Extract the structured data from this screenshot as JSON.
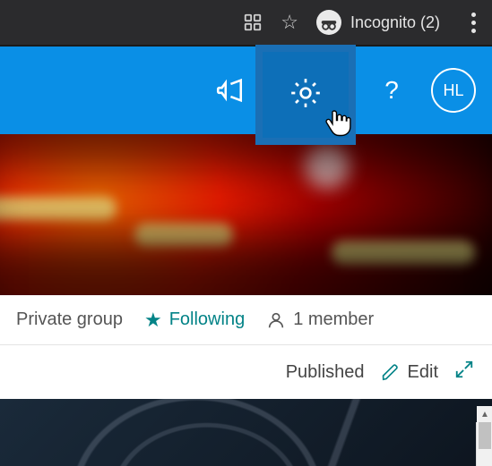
{
  "browser": {
    "incognito_label": "Incognito (2)"
  },
  "header": {
    "avatar_initials": "HL"
  },
  "meta": {
    "privacy": "Private group",
    "following_label": "Following",
    "members_count": "1 member"
  },
  "actions": {
    "status": "Published",
    "edit_label": "Edit"
  }
}
